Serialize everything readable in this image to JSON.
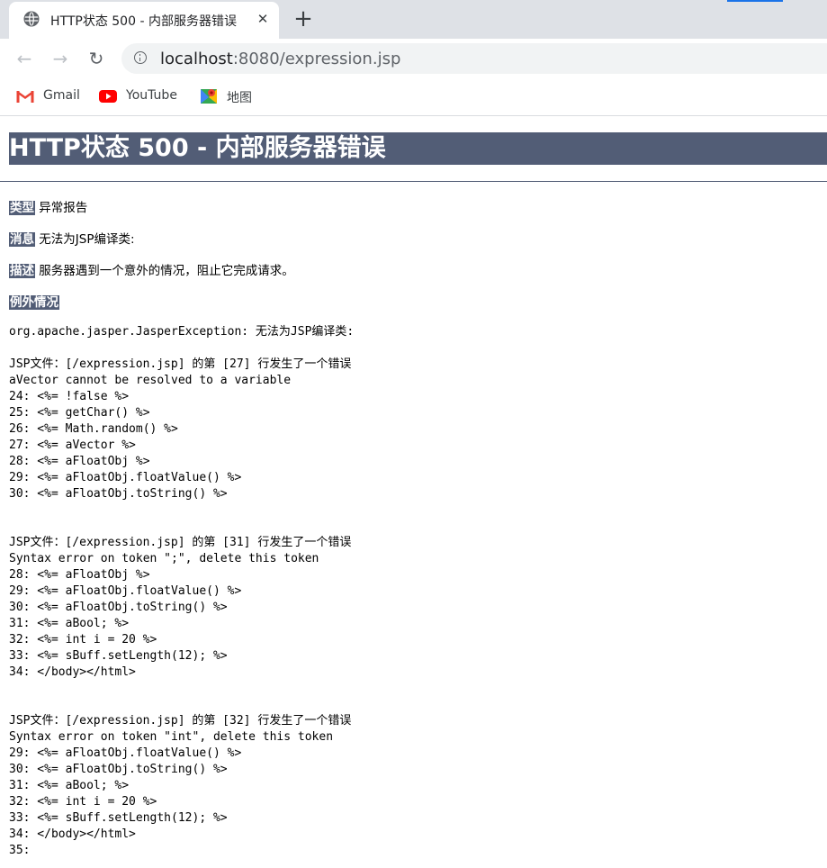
{
  "browser": {
    "tab_title": "HTTP状态 500 - 内部服务器错误",
    "tab_close": "✕",
    "new_tab": "+",
    "url_host": "localhost",
    "url_rest": ":8080/expression.jsp",
    "nav_back": "←",
    "nav_forward": "→",
    "nav_reload": "↻",
    "bookmarks": [
      {
        "label": "Gmail",
        "icon": "gmail-icon"
      },
      {
        "label": "YouTube",
        "icon": "youtube-icon"
      },
      {
        "label": "地图",
        "icon": "maps-icon"
      }
    ]
  },
  "page": {
    "heading": "HTTP状态 500 - 内部服务器错误",
    "type_label": "类型",
    "type_value": "异常报告",
    "message_label": "消息",
    "message_value": "无法为JSP编译类:",
    "description_label": "描述",
    "description_value": "服务器遇到一个意外的情况，阻止它完成请求。",
    "exception_label": "例外情况",
    "exception_text": "org.apache.jasper.JasperException: 无法为JSP编译类:",
    "errors": [
      {
        "header": "JSP文件：[/expression.jsp] 的第 [27] 行发生了一个错误",
        "message": "aVector cannot be resolved to a variable",
        "lines": [
          "24: <%= !false %>",
          "25: <%= getChar() %>",
          "26: <%= Math.random() %>",
          "27: <%= aVector %>",
          "28: <%= aFloatObj %>",
          "29: <%= aFloatObj.floatValue() %>",
          "30: <%= aFloatObj.toString() %>"
        ]
      },
      {
        "header": "JSP文件：[/expression.jsp] 的第 [31] 行发生了一个错误",
        "message": "Syntax error on token \";\", delete this token",
        "lines": [
          "28: <%= aFloatObj %>",
          "29: <%= aFloatObj.floatValue() %>",
          "30: <%= aFloatObj.toString() %>",
          "31: <%= aBool; %>",
          "32: <%= int i = 20 %>",
          "33: <%= sBuff.setLength(12); %>",
          "34: </body></html>"
        ]
      },
      {
        "header": "JSP文件：[/expression.jsp] 的第 [32] 行发生了一个错误",
        "message": "Syntax error on token \"int\", delete this token",
        "lines": [
          "29: <%= aFloatObj.floatValue() %>",
          "30: <%= aFloatObj.toString() %>",
          "31: <%= aBool; %>",
          "32: <%= int i = 20 %>",
          "33: <%= sBuff.setLength(12); %>",
          "34: </body></html>",
          "35:"
        ]
      }
    ]
  },
  "colors": {
    "label_bg": "#525d76",
    "tabstrip_bg": "#dee1e6",
    "omnibox_bg": "#f1f3f4"
  }
}
